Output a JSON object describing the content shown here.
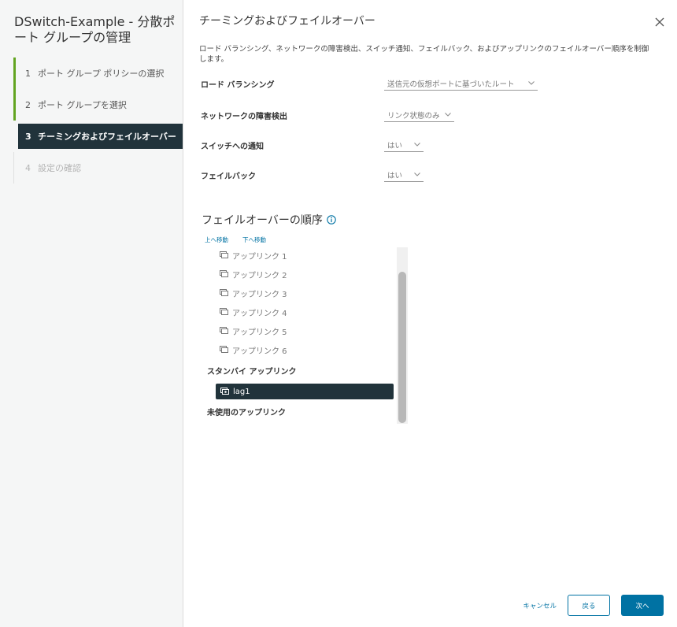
{
  "sidebar": {
    "title": "DSwitch-Example - 分散ポート グループの管理",
    "steps": [
      {
        "num": "1",
        "label": "ポート グループ ポリシーの選択"
      },
      {
        "num": "2",
        "label": "ポート グループを選択"
      },
      {
        "num": "3",
        "label": "チーミングおよびフェイルオーバー"
      },
      {
        "num": "4",
        "label": "設定の確認"
      }
    ]
  },
  "main": {
    "title": "チーミングおよびフェイルオーバー",
    "description": "ロード バランシング、ネットワークの障害検出、スイッチ通知、フェイルバック、およびアップリンクのフェイルオーバー順序を制御します。",
    "fields": {
      "load_balancing": {
        "label": "ロード バランシング",
        "value": "送信元の仮想ポートに基づいたルート"
      },
      "failure_detection": {
        "label": "ネットワークの障害検出",
        "value": "リンク状態のみ"
      },
      "notify_switches": {
        "label": "スイッチへの通知",
        "value": "はい"
      },
      "failback": {
        "label": "フェイルバック",
        "value": "はい"
      }
    },
    "failover_order": {
      "title": "フェイルオーバーの順序",
      "move_up": "上へ移動",
      "move_down": "下へ移動",
      "active_uplinks": [
        "アップリンク 1",
        "アップリンク 2",
        "アップリンク 3",
        "アップリンク 4",
        "アップリンク 5",
        "アップリンク 6"
      ],
      "standby_header": "スタンバイ アップリンク",
      "standby_uplinks": [
        "lag1"
      ],
      "unused_header": "未使用のアップリンク"
    }
  },
  "footer": {
    "cancel": "キャンセル",
    "back": "戻る",
    "next": "次へ"
  },
  "colors": {
    "accent": "#0072a3",
    "selected_bg": "#21333b",
    "done_bar": "#62a420"
  }
}
